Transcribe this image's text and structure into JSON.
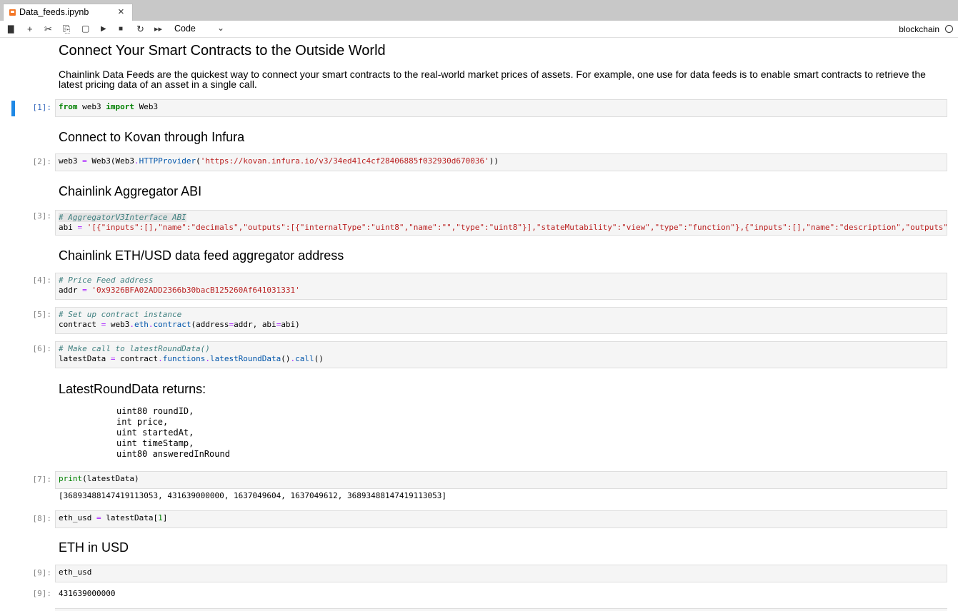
{
  "tab": {
    "title": "Data_feeds.ipynb",
    "close": "×"
  },
  "toolbar": {
    "save": "💾",
    "add": "+",
    "cut": "✂",
    "copy": "⎘",
    "paste": "📋",
    "run": "▶",
    "stop": "■",
    "restart": "C",
    "run_all": "▸▸",
    "cell_type": "Code",
    "kernel": "blockchain"
  },
  "cells": {
    "h1": "Connect Your Smart Contracts to the Outside World",
    "p1": "Chainlink Data Feeds are the quickest way to connect your smart contracts to the real-world market prices of assets. For example, one use for data feeds is to enable smart contracts to retrieve the latest pricing data of an asset in a single call.",
    "c1_prompt": "[1]:",
    "h2": "Connect to Kovan through Infura",
    "c2_prompt": "[2]:",
    "h3": "Chainlink Aggregator ABI",
    "c3_prompt": "[3]:",
    "h4": "Chainlink ETH/USD data feed aggregator address",
    "c4_prompt": "[4]:",
    "c5_prompt": "[5]:",
    "c6_prompt": "[6]:",
    "h5": "LatestRoundData returns:",
    "returns": "uint80 roundID,\nint price,\nuint startedAt,\nuint timeStamp,\nuint80 answeredInRound",
    "c7_prompt": "[7]:",
    "c7_out": "[36893488147419113053, 431639000000, 1637049604, 1637049612, 36893488147419113053]",
    "c8_prompt": "[8]:",
    "h6": "ETH in USD",
    "c9_prompt": "[9]:",
    "c9_out_prompt": "[9]:",
    "c9_out": "431639000000"
  }
}
